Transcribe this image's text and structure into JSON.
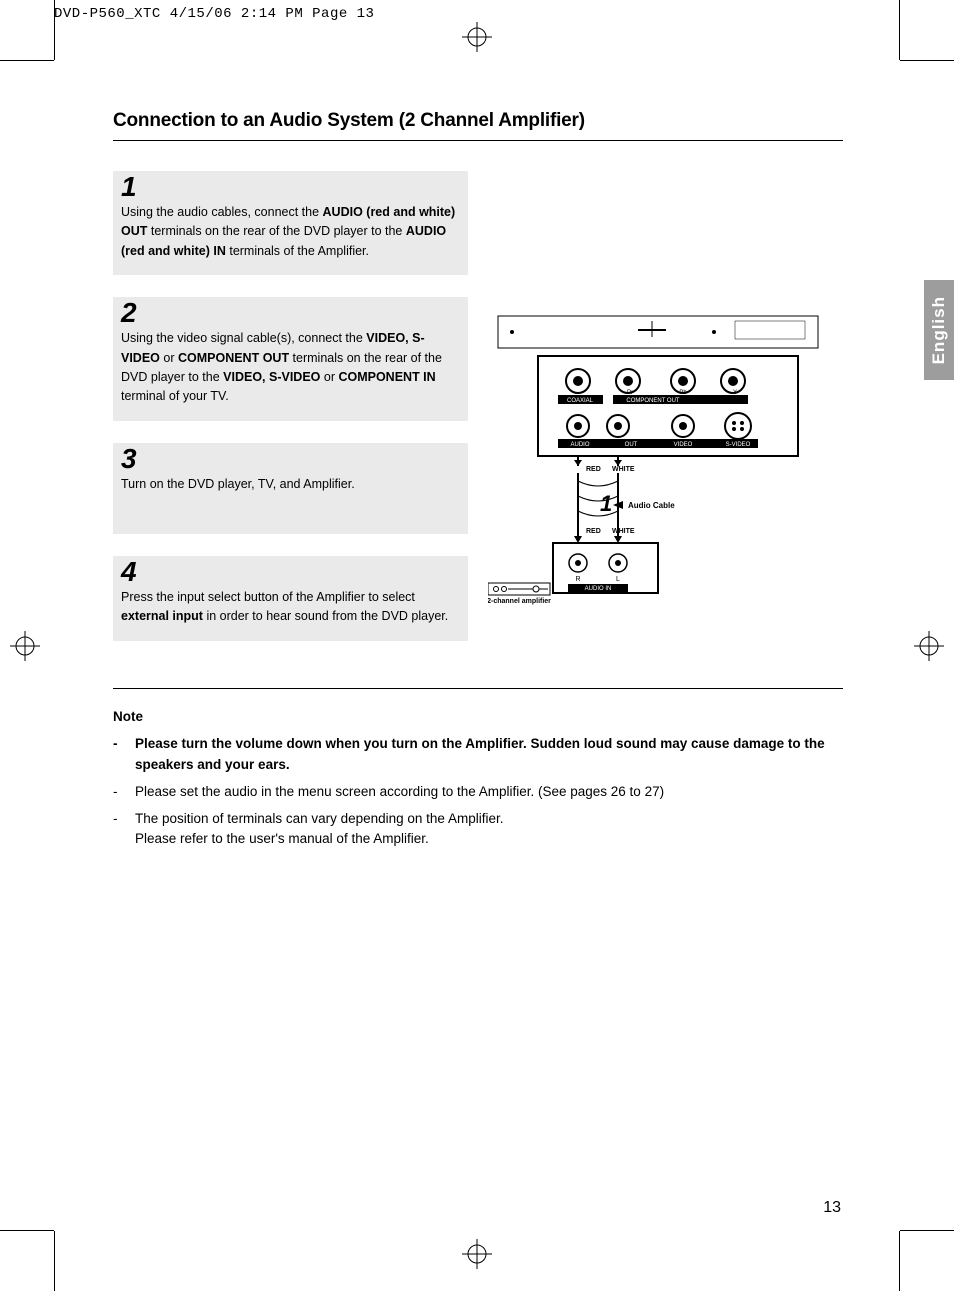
{
  "slug": "DVD-P560_XTC  4/15/06  2:14 PM  Page 13",
  "title": "Connection to an Audio System (2 Channel Amplifier)",
  "language_tab": "English",
  "page_number": "13",
  "steps": [
    {
      "num": "1",
      "text_before_1": "Using the audio cables, connect the ",
      "bold_1": "AUDIO (red and white) OUT",
      "text_mid_1": " terminals on the rear of the DVD player to the ",
      "bold_2": "AUDIO (red and white) IN",
      "text_after_1": " terminals of the Amplifier."
    },
    {
      "num": "2",
      "text_before_1": "Using the video signal cable(s), connect the ",
      "bold_1": "VIDEO, S-VIDEO",
      "text_mid_1": " or ",
      "bold_2": "COMPONENT OUT",
      "text_mid_2": " terminals on the rear of the DVD player to the ",
      "bold_3": "VIDEO, S-VIDEO",
      "text_mid_3": " or ",
      "bold_4": "COMPONENT IN",
      "text_after_1": " terminal of your TV."
    },
    {
      "num": "3",
      "text_plain": "Turn on the DVD player, TV, and Amplifier."
    },
    {
      "num": "4",
      "text_before_1": "Press the input select button of the Amplifier to select ",
      "bold_1": "external input",
      "text_after_1": "  in order to hear sound from the DVD player."
    }
  ],
  "diagram": {
    "top_labels": [
      "COAXIAL",
      "COMPONENT OUT",
      "Pr",
      "Pb",
      "Y"
    ],
    "row2_labels": [
      "AUDIO",
      "OUT",
      "VIDEO",
      "S-VIDEO"
    ],
    "red": "RED",
    "white": "WHITE",
    "callout_num": "1",
    "callout_label": "Audio Cable",
    "amp_label": "2-channel amplifier",
    "audio_in": "AUDIO IN",
    "r": "R",
    "l": "L"
  },
  "notes": {
    "heading": "Note",
    "items": [
      {
        "bold": true,
        "text": "Please turn the volume down when you turn on the Amplifier. Sudden loud sound may cause damage to the speakers and your ears."
      },
      {
        "bold": false,
        "text": "Please set the audio in the menu screen according to the Amplifier. (See pages 26 to 27)"
      },
      {
        "bold": false,
        "text": "The position of terminals can vary depending on the Amplifier.\nPlease refer to the user's manual of the Amplifier."
      }
    ]
  }
}
